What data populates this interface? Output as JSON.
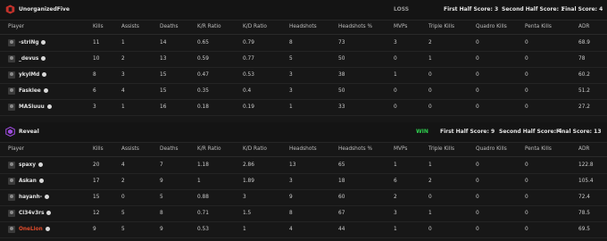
{
  "columns": [
    "Player",
    "Kills",
    "Assists",
    "Deaths",
    "K/R Ratio",
    "K/D Ratio",
    "Headshots",
    "Headshots %",
    "MVPs",
    "Triple Kills",
    "Quadro Kills",
    "Penta Kills",
    "ADR"
  ],
  "teams": [
    {
      "name": "UnorganizedFive",
      "result": "LOSS",
      "first_half": "First Half Score: 3",
      "second_half": "Second Half Score: 1",
      "final": "Final Score: 4",
      "players": [
        {
          "name": "-striNg",
          "stats": [
            "11",
            "1",
            "14",
            "0.65",
            "0.79",
            "8",
            "73",
            "3",
            "2",
            "0",
            "0",
            "68.9"
          ]
        },
        {
          "name": "_devus",
          "stats": [
            "10",
            "2",
            "13",
            "0.59",
            "0.77",
            "5",
            "50",
            "0",
            "1",
            "0",
            "0",
            "78"
          ]
        },
        {
          "name": "ykylMd",
          "stats": [
            "8",
            "3",
            "15",
            "0.47",
            "0.53",
            "3",
            "38",
            "1",
            "0",
            "0",
            "0",
            "60.2"
          ]
        },
        {
          "name": "Fasklee",
          "stats": [
            "6",
            "4",
            "15",
            "0.35",
            "0.4",
            "3",
            "50",
            "0",
            "0",
            "0",
            "0",
            "51.2"
          ]
        },
        {
          "name": "MASiuuu",
          "stats": [
            "3",
            "1",
            "16",
            "0.18",
            "0.19",
            "1",
            "33",
            "0",
            "0",
            "0",
            "0",
            "27.2"
          ]
        }
      ]
    },
    {
      "name": "Reveal",
      "result": "WIN",
      "first_half": "First Half Score: 9",
      "second_half": "Second Half Score: 4",
      "final": "Final Score: 13",
      "players": [
        {
          "name": "spaxy",
          "stats": [
            "20",
            "4",
            "7",
            "1.18",
            "2.86",
            "13",
            "65",
            "1",
            "1",
            "0",
            "0",
            "122.8"
          ]
        },
        {
          "name": "Askan",
          "stats": [
            "17",
            "2",
            "9",
            "1",
            "1.89",
            "3",
            "18",
            "6",
            "2",
            "0",
            "0",
            "105.4"
          ]
        },
        {
          "name": "hayanh-",
          "stats": [
            "15",
            "0",
            "5",
            "0.88",
            "3",
            "9",
            "60",
            "2",
            "0",
            "0",
            "0",
            "72.4"
          ]
        },
        {
          "name": "Cl34v3rs",
          "stats": [
            "12",
            "5",
            "8",
            "0.71",
            "1.5",
            "8",
            "67",
            "3",
            "1",
            "0",
            "0",
            "78.5"
          ]
        },
        {
          "name": "OneLion",
          "stats": [
            "9",
            "5",
            "9",
            "0.53",
            "1",
            "4",
            "44",
            "1",
            "0",
            "0",
            "0",
            "69.5"
          ]
        }
      ]
    }
  ],
  "colors": {
    "background": "#171717",
    "win": "#2fd04f",
    "loss": "#9a9a9a",
    "highlight_player": "#e14b2b",
    "logo_a": "#c4322b",
    "logo_b": "#9a4ad9"
  },
  "icons": {
    "team_a_logo": "unorganizedfive-logo-icon",
    "team_b_logo": "reveal-logo-icon",
    "verified": "verified-check-icon"
  }
}
